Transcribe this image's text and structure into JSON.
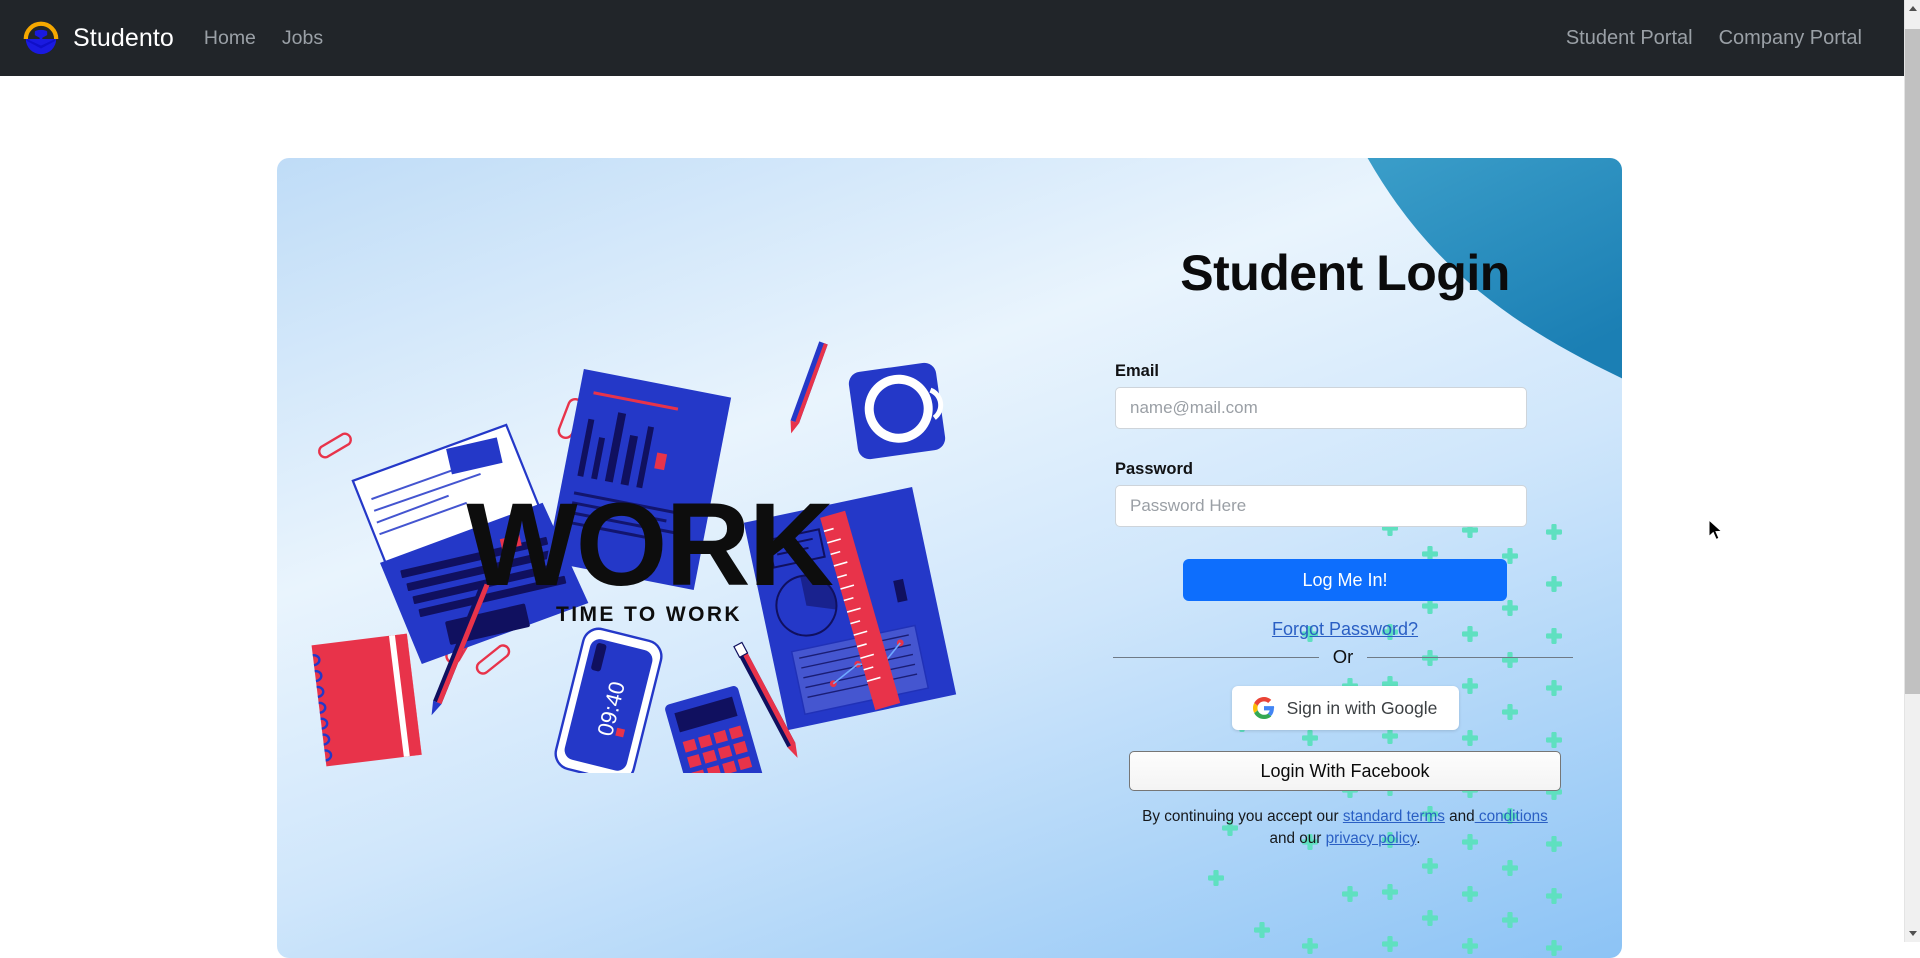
{
  "navbar": {
    "brand": {
      "name": "Studento",
      "logo_icon": "graduation-emblem-icon"
    },
    "left_links": [
      {
        "label": "Home"
      },
      {
        "label": "Jobs"
      }
    ],
    "right_links": [
      {
        "label": "Student Portal"
      },
      {
        "label": "Company Portal"
      }
    ],
    "background_color": "#212529",
    "brand_text_color": "#ffffff",
    "link_color": "#9aa0a6"
  },
  "login_card": {
    "title": "Student Login",
    "accent_color": "#0d6efd",
    "corner_blob_color": "#2389bd",
    "plus_decoration_color": "#5fe0c0",
    "email": {
      "label": "Email",
      "placeholder": "name@mail.com",
      "value": ""
    },
    "password": {
      "label": "Password",
      "placeholder": "Password Here",
      "value": ""
    },
    "submit_label": "Log Me In!",
    "forgot_password_label": "Forgot Password?",
    "or_label": "Or",
    "google_label": "Sign in with Google",
    "google_icon": "google-g-icon",
    "facebook_label": "Login With Facebook",
    "terms": {
      "prefix": "By continuing you accept our ",
      "link_terms": "standard terms",
      "mid": " and",
      "link_conditions": " conditions",
      "mid2": " and our ",
      "link_privacy": "privacy policy",
      "suffix": "."
    }
  },
  "illustration": {
    "headline": "WORK",
    "subhead": "TIME TO WORK",
    "phone_time": "09:40",
    "palette": {
      "blue": "#2438c8",
      "red": "#e8334a",
      "dark": "#0d0d0d"
    }
  },
  "scrollbar": {
    "up_icon": "scroll-up-arrow-icon",
    "down_icon": "scroll-down-arrow-icon"
  },
  "cursor": {
    "icon": "mouse-pointer-icon"
  }
}
